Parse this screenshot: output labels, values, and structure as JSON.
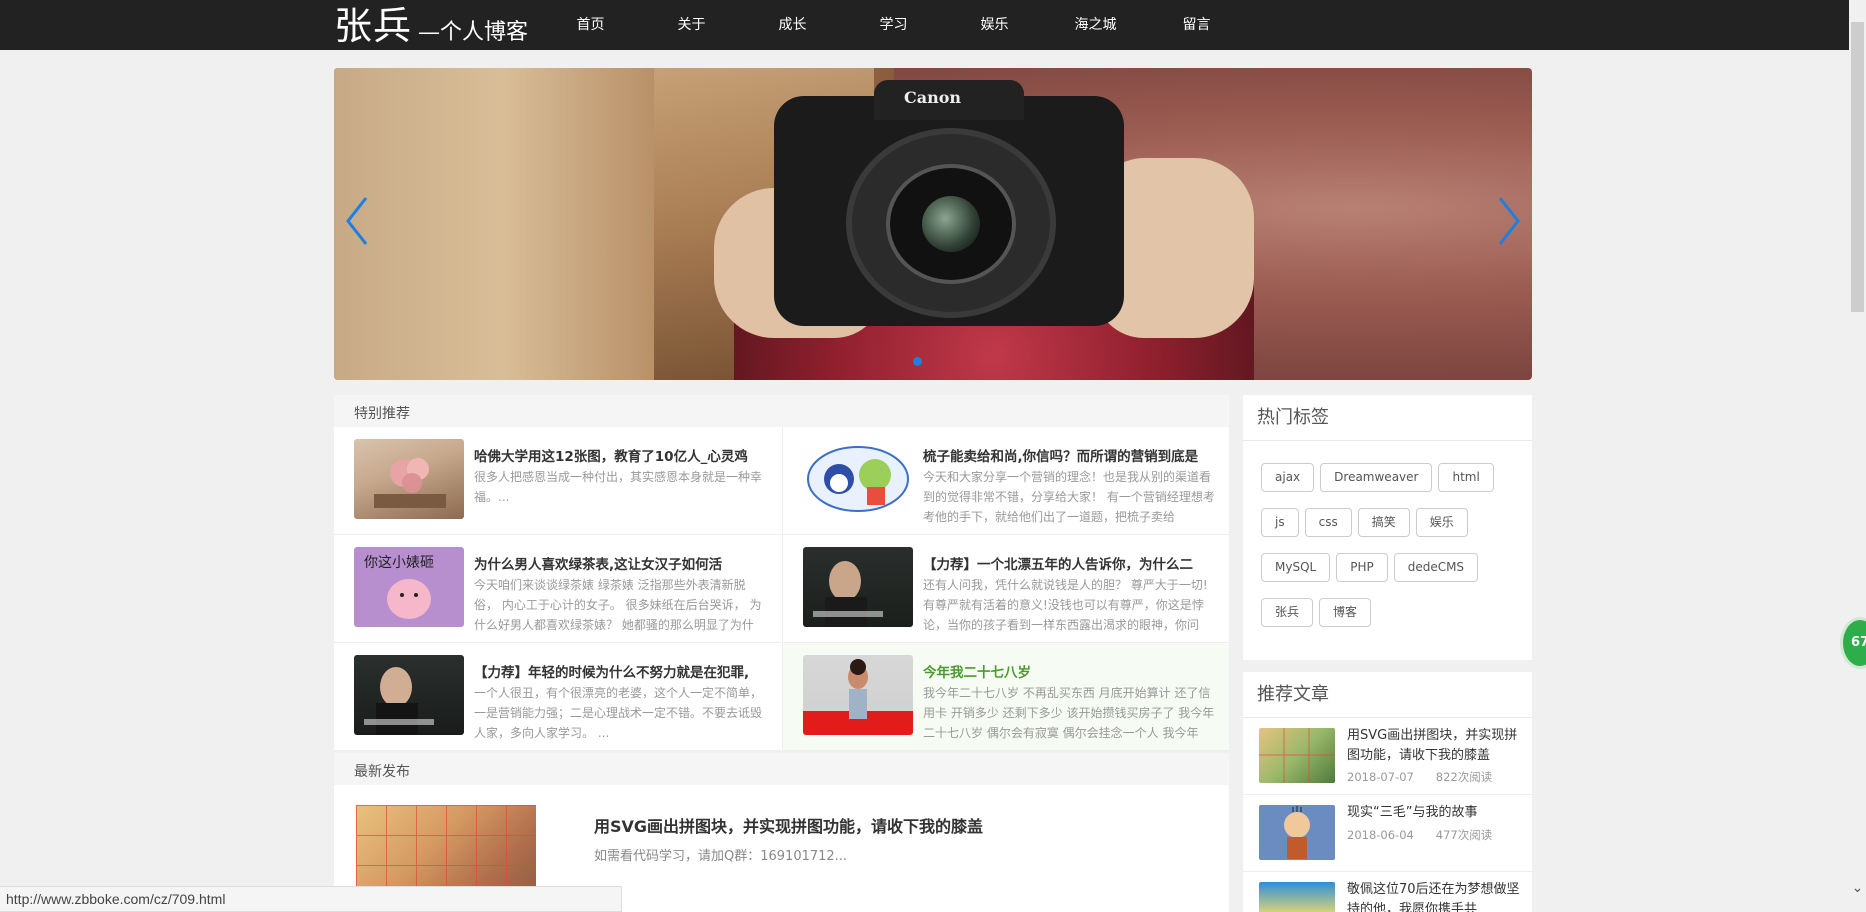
{
  "header": {
    "logo_main": "张兵",
    "logo_sub": "—个人博客",
    "nav": [
      "首页",
      "关于",
      "成长",
      "学习",
      "娱乐",
      "海之城",
      "留言"
    ]
  },
  "banner": {
    "camera_brand": "Canon",
    "slide_index": 1,
    "slide_count": 1
  },
  "featured": {
    "title": "特别推荐",
    "items": [
      {
        "title": "哈佛大学用这12张图，教育了10亿人_心灵鸡",
        "desc": "很多人把感恩当成一种付出，其实感恩本身就是一种幸福。..."
      },
      {
        "title": "梳子能卖给和尚,你信吗？而所谓的营销到底是",
        "desc": "今天和大家分享一个营销的理念！也是我从别的渠道看到的觉得非常不错，分享给大家！ 有一个营销经理想考考他的手下，就给他们出了一道题，把梳子卖给"
      },
      {
        "title": "为什么男人喜欢绿茶表,这让女汉子如何活",
        "desc": "今天咱们来谈谈绿茶婊 绿茶婊 泛指那些外表清新脱俗， 内心工于心计的女子。 很多妹纸在后台哭诉， 为什么好男人都喜欢绿茶婊？ 她都骚的那么明显了为什"
      },
      {
        "title": "【力荐】一个北漂五年的人告诉你，为什么二",
        "desc": "还有人问我，凭什么就说钱是人的胆？ 尊严大于一切! 有尊严就有活着的意义!没钱也可以有尊严，你这是悖论，当你的孩子看到一样东西露出渴求的眼神，你问"
      },
      {
        "title": "【力荐】年轻的时候为什么不努力就是在犯罪,",
        "desc": "一个人很丑，有个很漂亮的老婆，这个人一定不简单，一是营销能力强；二是心理战术一定不错。不要去诋毁人家，多向人家学习。 ..."
      },
      {
        "title": "今年我二十七八岁",
        "desc": "我今年二十七八岁 不再乱买东西 月底开始算计 还了信用卡 开销多少 还剩下多少 该开始攒钱买房子了 我今年二十七八岁 偶尔会有寂寞 偶尔会挂念一个人 我今年"
      }
    ]
  },
  "latest": {
    "title": "最新发布",
    "item_title": "用SVG画出拼图块，并实现拼图功能，请收下我的膝盖",
    "item_desc": "如需看代码学习，请加Q群：169101712..."
  },
  "tags": {
    "title": "热门标签",
    "list": [
      "ajax",
      "Dreamweaver",
      "html",
      "js",
      "css",
      "搞笑",
      "娱乐",
      "MySQL",
      "PHP",
      "dedeCMS",
      "张兵",
      "博客"
    ]
  },
  "recommended": {
    "title": "推荐文章",
    "items": [
      {
        "title": "用SVG画出拼图块，并实现拼图功能，请收下我的膝盖",
        "date": "2018-07-07",
        "reads": "822次阅读"
      },
      {
        "title": "现实“三毛”与我的故事",
        "date": "2018-06-04",
        "reads": "477次阅读"
      },
      {
        "title": "敬佩这位70后还在为梦想做坚持的他，我愿你携手共",
        "date": "",
        "reads": ""
      }
    ]
  },
  "side_badge": "67",
  "statusbar": "http://www.zbboke.com/cz/709.html"
}
